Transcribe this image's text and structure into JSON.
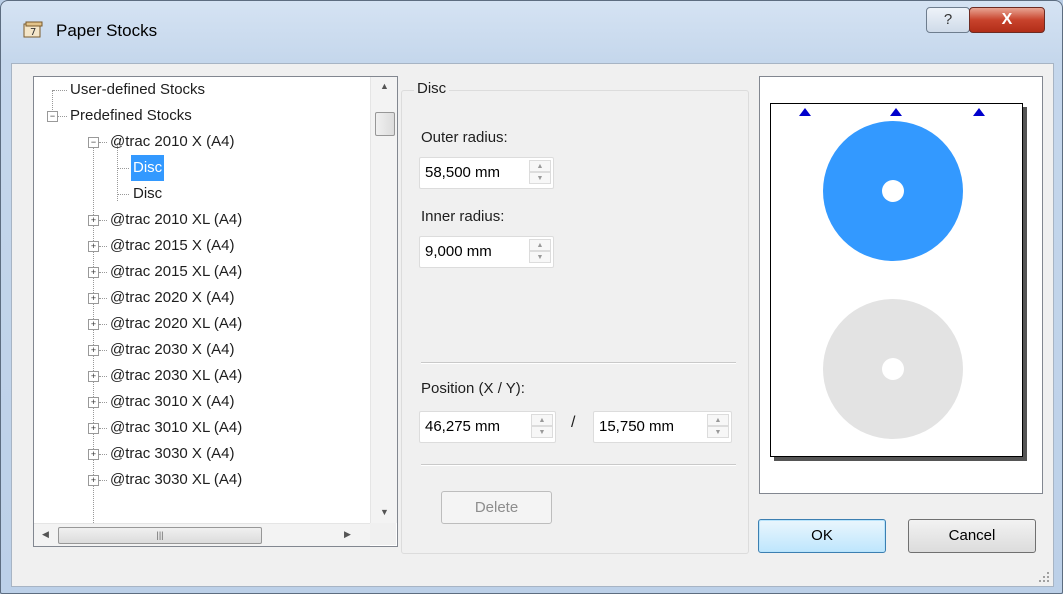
{
  "window": {
    "title": "Paper Stocks",
    "help_glyph": "?",
    "close_glyph": "X"
  },
  "tree": {
    "root_user": "User-defined Stocks",
    "root_predefined": "Predefined Stocks",
    "expanded_item": "@trac 2010 X (A4)",
    "children": [
      "Disc",
      "Disc"
    ],
    "items": [
      "@trac 2010 XL (A4)",
      "@trac 2015 X (A4)",
      "@trac 2015 XL (A4)",
      "@trac 2020 X (A4)",
      "@trac 2020 XL (A4)",
      "@trac 2030 X (A4)",
      "@trac 2030 XL (A4)",
      "@trac 3010 X (A4)",
      "@trac 3010 XL (A4)",
      "@trac 3030 X (A4)",
      "@trac 3030 XL (A4)"
    ]
  },
  "group": {
    "title": "Disc",
    "outer_radius_label": "Outer radius:",
    "outer_radius_value": "58,500 mm",
    "inner_radius_label": "Inner radius:",
    "inner_radius_value": "9,000 mm",
    "position_label": "Position (X / Y):",
    "position_x_value": "46,275 mm",
    "position_separator": "/",
    "position_y_value": "15,750 mm",
    "delete_label": "Delete"
  },
  "preview": {
    "active_disc_color": "#3399ff",
    "inactive_disc_color": "#e3e3e3",
    "marker_color": "#0000cc"
  },
  "buttons": {
    "ok_label": "OK",
    "cancel_label": "Cancel"
  }
}
